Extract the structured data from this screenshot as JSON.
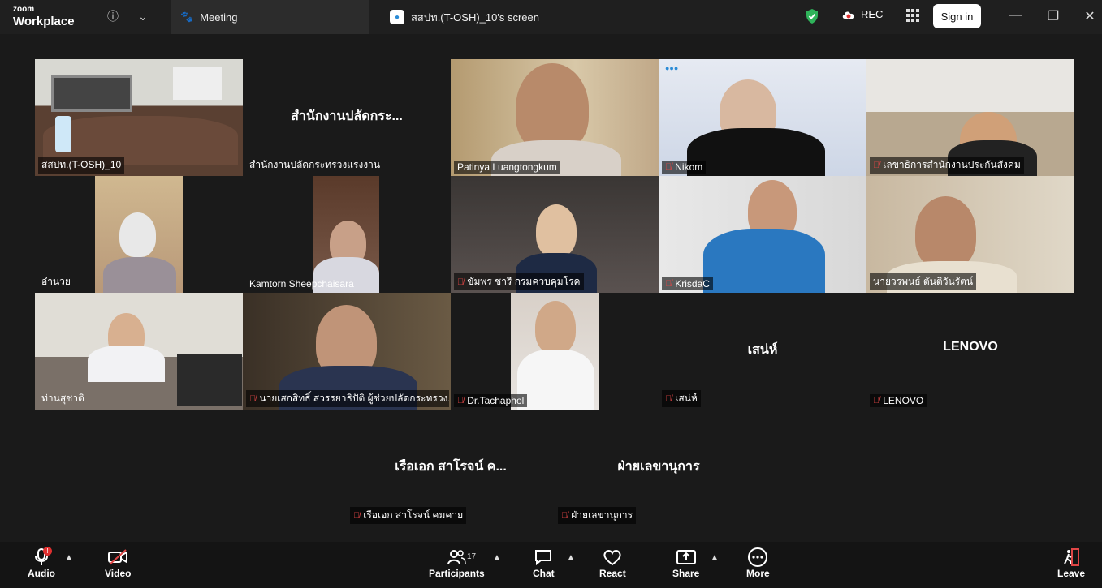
{
  "titlebar": {
    "logo_line1": "zoom",
    "logo_line2": "Workplace",
    "tab_meeting": "Meeting",
    "tab_screen": "สสปท.(T-OSH)_10's screen",
    "rec_label": "REC",
    "signin_label": "Sign in"
  },
  "tiles": [
    {
      "name": "สสปท.(T-OSH)_10",
      "muted": false,
      "active": true
    },
    {
      "name": "สำนักงานปลัดกระทรวงแรงงาน",
      "bigname": "สำนักงานปลัดกระ...",
      "muted": false
    },
    {
      "name": "Patinya Luangtongkum",
      "muted": false
    },
    {
      "name": "Nikom",
      "muted": true
    },
    {
      "name": "เลขาธิการสำนักงานประกันสังคม",
      "muted": true
    },
    {
      "name": "อำนวย",
      "muted": false
    },
    {
      "name": "Kamtorn Sheepchaisara",
      "muted": false
    },
    {
      "name": "ขัมพร ชารี กรมควบคุมโรค",
      "muted": true
    },
    {
      "name": "KrisdaC",
      "muted": true
    },
    {
      "name": "นายวรพนธ์ ตันติวันรัตน์",
      "muted": false
    },
    {
      "name": "ท่านสุชาติ",
      "muted": false
    },
    {
      "name": "นายเสกสิทธิ์ สวรรยาธิปัติ ผู้ช่วยปลัดกระทรวง...",
      "muted": true
    },
    {
      "name": "Dr.Tachaphol",
      "muted": true
    },
    {
      "name": "เสน่ห์",
      "bigname": "เสน่ห์",
      "muted": true
    },
    {
      "name": "LENOVO",
      "bigname": "LENOVO",
      "muted": true
    },
    {
      "name": "เรือเอก สาโรจน์ คมคาย",
      "bigname": "เรือเอก สาโรจน์ ค...",
      "muted": true
    },
    {
      "name": "ฝ่ายเลขานุการ",
      "bigname": "ฝ่ายเลขานุการ",
      "muted": true
    }
  ],
  "toolbar": {
    "audio": "Audio",
    "video": "Video",
    "participants": "Participants",
    "participant_count": "17",
    "chat": "Chat",
    "react": "React",
    "share": "Share",
    "more": "More",
    "leave": "Leave",
    "audio_badge": "!"
  },
  "colors": {
    "active_speaker": "#3cc26a",
    "mute": "#e04646",
    "background": "#1a1a1a"
  }
}
